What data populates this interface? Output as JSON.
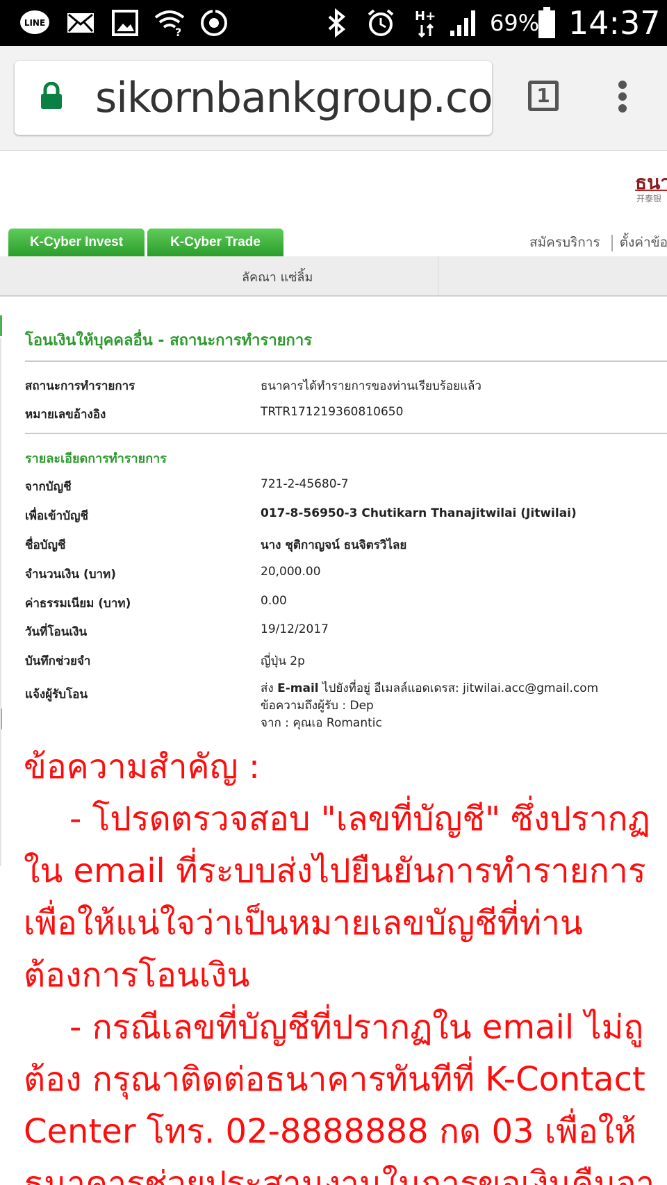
{
  "status_bar": {
    "battery_percent": "69%",
    "clock": "14:37",
    "icons": [
      "line-app-icon",
      "mail-icon",
      "image-icon",
      "wifi-question-icon",
      "sync-icon",
      "bluetooth-icon",
      "alarm-icon",
      "hplus-data-icon",
      "signal-icon",
      "battery-icon"
    ]
  },
  "browser": {
    "url": "sikornbankgroup.com",
    "tab_count": "1"
  },
  "header": {
    "bank_logo": "ธนา",
    "bank_logo_sub": "开泰银",
    "tabs": [
      "K-Cyber Invest",
      "K-Cyber Trade"
    ],
    "links": [
      "สมัครบริการ",
      "ตั้งค่าข้อ"
    ],
    "user_name": "ลัคณา แซ่ลิ้ม"
  },
  "transaction": {
    "title": "โอนเงินให้บุคคลอื่น - สถานะการทำรายการ",
    "status_label": "สถานะการทำรายการ",
    "status_value": "ธนาคารได้ทำรายการของท่านเรียบร้อยแล้ว",
    "ref_label": "หมายเลขอ้างอิง",
    "ref_value": "TRTR171219360810650",
    "details_heading": "รายละเอียดการทำรายการ",
    "from_label": "จากบัญชี",
    "from_value": "721-2-45680-7",
    "to_label": "เพื่อเข้าบัญชี",
    "to_value": "017-8-56950-3 Chutikarn Thanajitwilai (Jitwilai)",
    "name_label": "ชื่อบัญชี",
    "name_value": "นาง ชุติกาญจน์ ธนจิตรวิไลย",
    "amount_label": "จำนวนเงิน (บาท)",
    "amount_value": "20,000.00",
    "fee_label": "ค่าธรรมเนียม (บาท)",
    "fee_value": "0.00",
    "date_label": "วันที่โอนเงิน",
    "date_value": "19/12/2017",
    "memo_label": "บันทึกช่วยจำ",
    "memo_value": "ญี่ปุ่น 2p",
    "notify_label": "แจ้งผู้รับโอน",
    "notify_prefix": "ส่ง ",
    "notify_bold": "E-mail",
    "notify_rest": " ไปยังที่อยู่ อีเมลล์แอดเดรส: jitwilai.acc@gmail.com",
    "notify_line2": "ข้อความถึงผู้รับ : Dep",
    "notify_line3": "จาก : คุณเอ Romantic"
  },
  "important_note": {
    "heading": "ข้อความสำคัญ :",
    "lines": [
      "- โปรดตรวจสอบ \"เลขที่บัญชี\" ซึ่งปรากฏ",
      "ใน email ที่ระบบส่งไปยืนยันการทำรายการ",
      "เพื่อให้แน่ใจว่าเป็นหมายเลขบัญชีที่ท่าน",
      "ต้องการโอนเงิน",
      "- กรณีเลขที่บัญชีที่ปรากฏใน email ไม่ถู",
      "ต้อง กรุณาติดต่อธนาคารทันทีที่ K-Contact",
      "Center โทร. 02-8888888 กด 03 เพื่อให้",
      "ธนาคารช่วยประสานงานในการขอเงินคืนจา"
    ]
  }
}
